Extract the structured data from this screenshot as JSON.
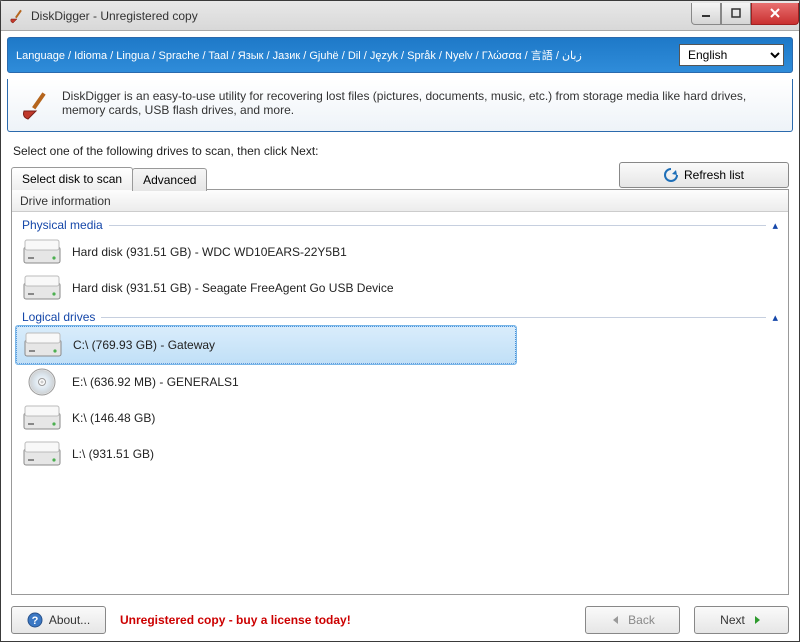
{
  "window": {
    "title": "DiskDigger - Unregistered copy"
  },
  "header": {
    "language_labels": "Language / Idioma / Lingua / Sprache / Taal / Язык / Jазик / Gjuhë / Dil / Język / Språk / Nyelv / Γλώσσα / 言語 / زبان",
    "language_selected": "English"
  },
  "description": "DiskDigger is an easy-to-use utility for recovering lost files (pictures, documents, music, etc.) from storage media like hard drives, memory cards, USB flash drives, and more.",
  "instruction": "Select one of the following drives to scan, then click Next:",
  "tabs": {
    "select_disk": "Select disk to scan",
    "advanced": "Advanced"
  },
  "buttons": {
    "refresh": "Refresh list",
    "about": "About...",
    "back": "Back",
    "next": "Next"
  },
  "column_header": "Drive information",
  "groups": {
    "physical": "Physical media",
    "logical": "Logical drives"
  },
  "drives": {
    "physical": [
      {
        "label": "Hard disk (931.51 GB) - WDC WD10EARS-22Y5B1",
        "type": "hdd"
      },
      {
        "label": "Hard disk (931.51 GB) - Seagate FreeAgent Go USB Device",
        "type": "hdd"
      }
    ],
    "logical": [
      {
        "label": "C:\\ (769.93 GB) - Gateway",
        "type": "hdd",
        "selected": true
      },
      {
        "label": "E:\\ (636.92 MB) - GENERALS1",
        "type": "cd"
      },
      {
        "label": "K:\\ (146.48 GB)",
        "type": "hdd"
      },
      {
        "label": "L:\\ (931.51 GB)",
        "type": "hdd"
      }
    ]
  },
  "footer": {
    "unregistered": "Unregistered copy - buy a license today!"
  }
}
